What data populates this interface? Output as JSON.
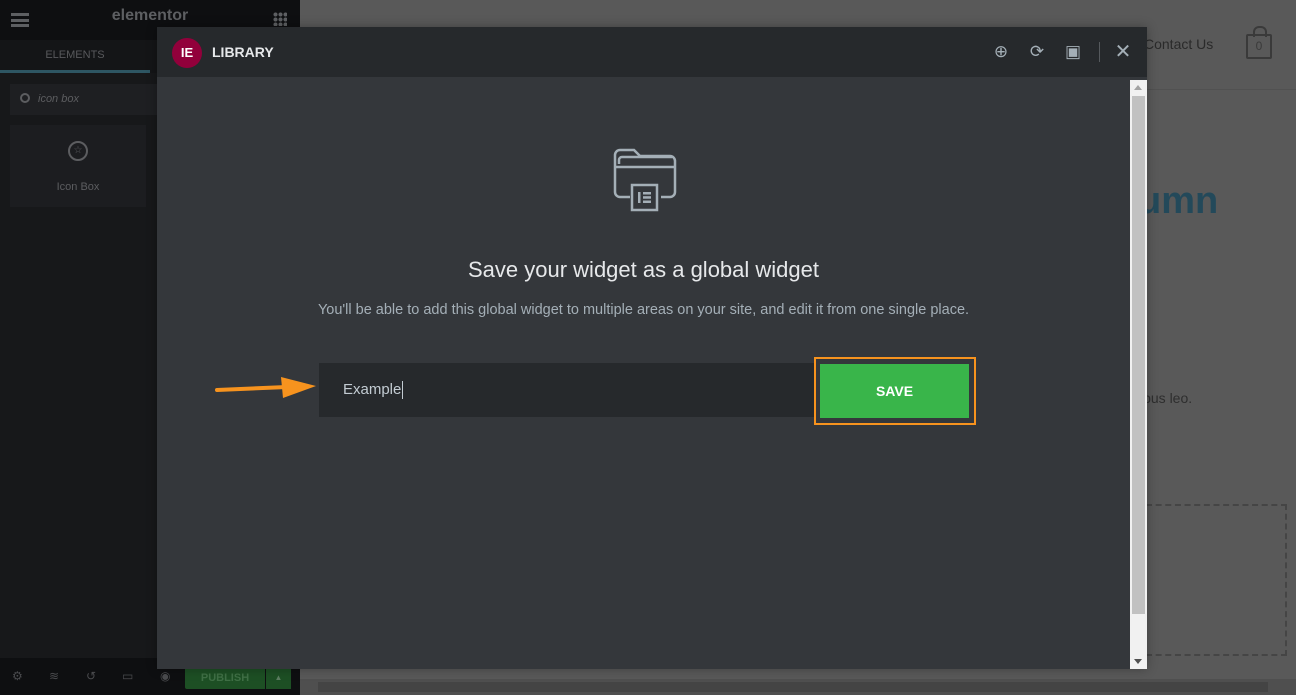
{
  "sidebar": {
    "logo": "elementor",
    "tab": "ELEMENTS",
    "search_value": "icon box",
    "widget_label": "Icon Box",
    "publish_label": "PUBLISH"
  },
  "site": {
    "nav_item": "Contact Us",
    "cart_count": "0",
    "heading_fragment": "umn",
    "para_fragment": "ibus leo."
  },
  "modal": {
    "title": "LIBRARY",
    "logo_letter": "IE",
    "heading": "Save your widget as a global widget",
    "description": "You'll be able to add this global widget to multiple areas on your site, and edit it from one single place.",
    "input_value": "Example",
    "save_label": "SAVE"
  },
  "colors": {
    "accent_brand": "#92003b",
    "save_green": "#39b54a",
    "highlight_orange": "#f7931e"
  }
}
